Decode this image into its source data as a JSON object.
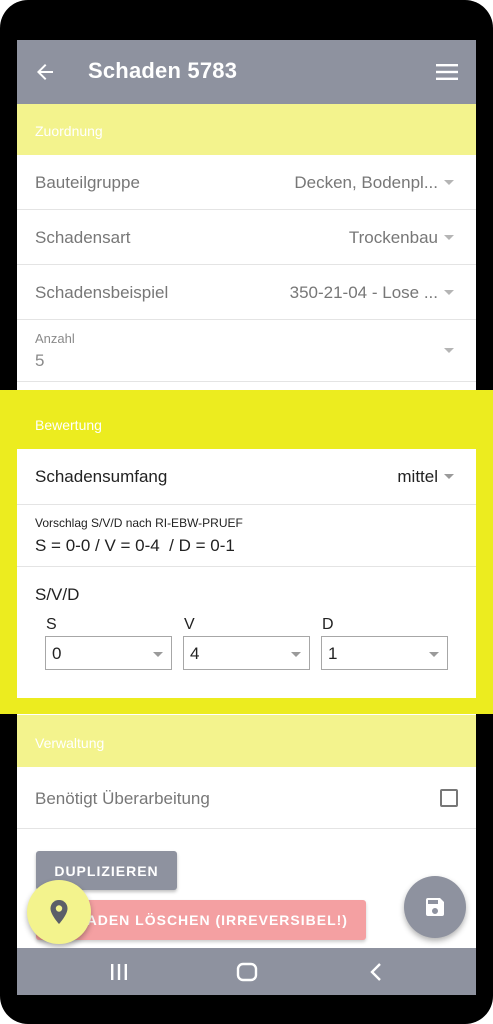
{
  "appbar": {
    "title": "Schaden 5783",
    "back_icon": "arrow-left-icon",
    "menu_icon": "hamburger-menu-icon"
  },
  "zuordnung": {
    "header": "Zuordnung",
    "bauteilgruppe": {
      "label": "Bauteilgruppe",
      "value": "Decken, Bodenpl..."
    },
    "schadensart": {
      "label": "Schadensart",
      "value": "Trockenbau"
    },
    "schadensbeispiel": {
      "label": "Schadensbeispiel",
      "value": "350-21-04 - Lose ..."
    },
    "anzahl": {
      "label": "Anzahl",
      "value": "5"
    }
  },
  "bewertung": {
    "header": "Bewertung",
    "schadensumfang": {
      "label": "Schadensumfang",
      "value": "mittel"
    },
    "vorschlag": {
      "title": "Vorschlag S/V/D nach RI-EBW-PRUEF",
      "text": "S = 0-0 / V = 0-4  / D = 0-1"
    },
    "svd": {
      "title": "S/V/D",
      "s": {
        "label": "S",
        "value": "0"
      },
      "v": {
        "label": "V",
        "value": "4"
      },
      "d": {
        "label": "D",
        "value": "1"
      }
    }
  },
  "verwaltung": {
    "header": "Verwaltung",
    "ueberarbeitung": {
      "label": "Benötigt Überarbeitung",
      "checked": false
    }
  },
  "buttons": {
    "duplizieren": "DUPLIZIEREN",
    "loeschen": "SCHADEN LÖSCHEN (IRREVERSIBEL!)"
  },
  "colors": {
    "primary": "#8e929f",
    "section": "#f3f38d",
    "highlight": "#ecec1f",
    "danger": "#f4a0a2"
  },
  "fab": {
    "location_icon": "map-pin-icon",
    "save_icon": "save-icon"
  },
  "system_nav": {
    "recents_icon": "recents-icon",
    "home_icon": "home-icon",
    "back_icon": "back-chevron-icon"
  }
}
